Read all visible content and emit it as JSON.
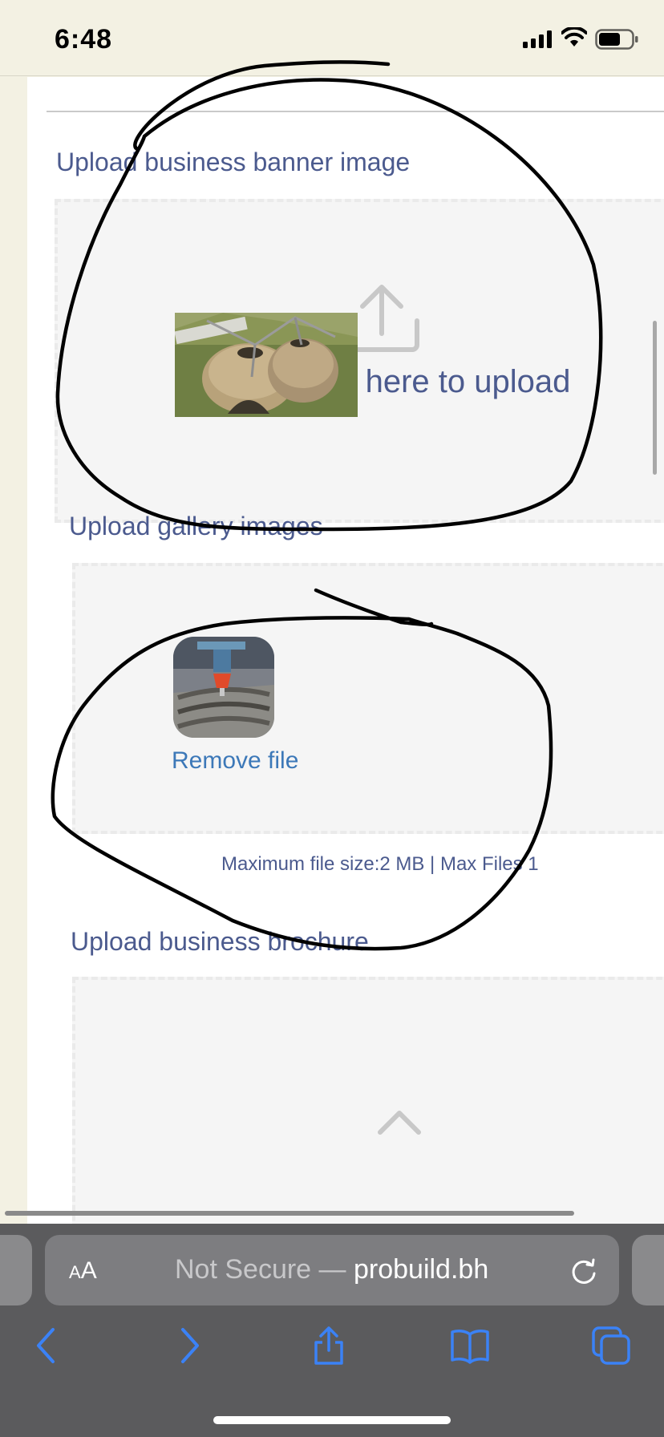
{
  "status_bar": {
    "time": "6:48",
    "icons": [
      "cellular-signal-icon",
      "wifi-icon",
      "battery-icon"
    ]
  },
  "form": {
    "banner": {
      "label": "Upload business banner image",
      "drop_text": "Drop image here to upload",
      "visible_drop_text": "ge here to upload",
      "icon": "upload-icon"
    },
    "gallery": {
      "label": "Upload gallery images",
      "remove_label": "Remove file",
      "hint": "Maximum file size:2 MB | Max Files 1"
    },
    "brochure": {
      "label": "Upload business brochure"
    }
  },
  "browser": {
    "aa_small": "A",
    "aa_large": "A",
    "url_prefix": "Not Secure — ",
    "url_host": "probuild.bh",
    "toolbar_icons": [
      "back-icon",
      "forward-icon",
      "share-icon",
      "bookmarks-icon",
      "tabs-icon"
    ]
  },
  "colors": {
    "label": "#4b5a8e",
    "link": "#3c78b8",
    "toolbar_bg": "#5b5b5d",
    "tint": "#3b82f6",
    "dropzone": "#f5f5f5",
    "status_bg": "#f3f1e3"
  }
}
